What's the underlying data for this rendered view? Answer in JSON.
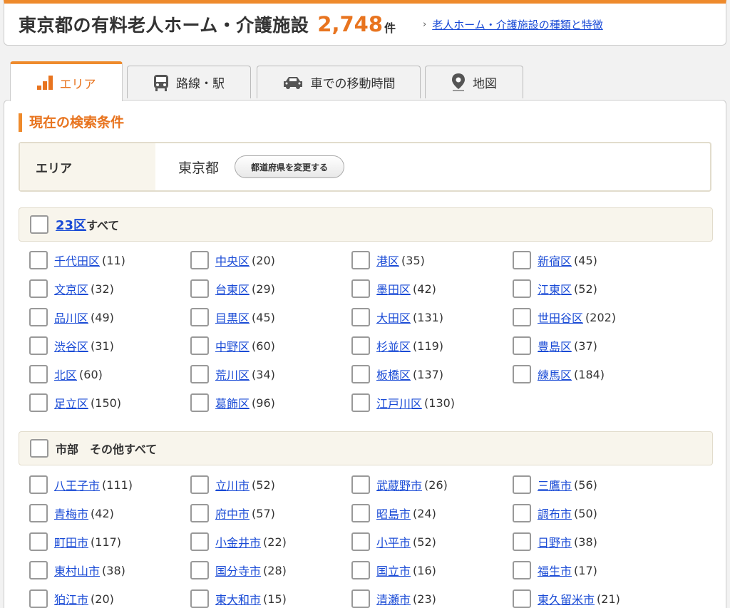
{
  "header": {
    "title": "東京都の有料老人ホーム・介護施設",
    "count": "2,748",
    "unit": "件",
    "guide_link": "老人ホーム・介護施設の種類と特徴"
  },
  "tabs": [
    {
      "label": "エリア",
      "icon": "area-bar-icon"
    },
    {
      "label": "路線・駅",
      "icon": "train-icon"
    },
    {
      "label": "車での移動時間",
      "icon": "car-icon"
    },
    {
      "label": "地図",
      "icon": "map-pin-icon"
    }
  ],
  "search": {
    "section_title": "現在の検索条件",
    "area_label": "エリア",
    "area_value": "東京都",
    "change_button": "都道府県を変更する"
  },
  "wards": {
    "all_link": "23区",
    "all_suffix": "すべて",
    "items": [
      {
        "name": "千代田区",
        "count": "(11)"
      },
      {
        "name": "中央区",
        "count": "(20)"
      },
      {
        "name": "港区",
        "count": "(35)"
      },
      {
        "name": "新宿区",
        "count": "(45)"
      },
      {
        "name": "文京区",
        "count": "(32)"
      },
      {
        "name": "台東区",
        "count": "(29)"
      },
      {
        "name": "墨田区",
        "count": "(42)"
      },
      {
        "name": "江東区",
        "count": "(52)"
      },
      {
        "name": "品川区",
        "count": "(49)"
      },
      {
        "name": "目黒区",
        "count": "(45)"
      },
      {
        "name": "大田区",
        "count": "(131)"
      },
      {
        "name": "世田谷区",
        "count": "(202)"
      },
      {
        "name": "渋谷区",
        "count": "(31)"
      },
      {
        "name": "中野区",
        "count": "(60)"
      },
      {
        "name": "杉並区",
        "count": "(119)"
      },
      {
        "name": "豊島区",
        "count": "(37)"
      },
      {
        "name": "北区",
        "count": "(60)"
      },
      {
        "name": "荒川区",
        "count": "(34)"
      },
      {
        "name": "板橋区",
        "count": "(137)"
      },
      {
        "name": "練馬区",
        "count": "(184)"
      },
      {
        "name": "足立区",
        "count": "(150)"
      },
      {
        "name": "葛飾区",
        "count": "(96)"
      },
      {
        "name": "江戸川区",
        "count": "(130)"
      }
    ]
  },
  "cities": {
    "all_label": "市部　その他すべて",
    "items": [
      {
        "name": "八王子市",
        "count": "(111)"
      },
      {
        "name": "立川市",
        "count": "(52)"
      },
      {
        "name": "武蔵野市",
        "count": "(26)"
      },
      {
        "name": "三鷹市",
        "count": "(56)"
      },
      {
        "name": "青梅市",
        "count": "(42)"
      },
      {
        "name": "府中市",
        "count": "(57)"
      },
      {
        "name": "昭島市",
        "count": "(24)"
      },
      {
        "name": "調布市",
        "count": "(50)"
      },
      {
        "name": "町田市",
        "count": "(117)"
      },
      {
        "name": "小金井市",
        "count": "(22)"
      },
      {
        "name": "小平市",
        "count": "(52)"
      },
      {
        "name": "日野市",
        "count": "(38)"
      },
      {
        "name": "東村山市",
        "count": "(38)"
      },
      {
        "name": "国分寺市",
        "count": "(28)"
      },
      {
        "name": "国立市",
        "count": "(16)"
      },
      {
        "name": "福生市",
        "count": "(17)"
      },
      {
        "name": "狛江市",
        "count": "(20)"
      },
      {
        "name": "東大和市",
        "count": "(15)"
      },
      {
        "name": "清瀬市",
        "count": "(23)"
      },
      {
        "name": "東久留米市",
        "count": "(21)"
      }
    ]
  },
  "colors": {
    "accent": "#ee8a2c",
    "link": "#1a4bd6"
  }
}
